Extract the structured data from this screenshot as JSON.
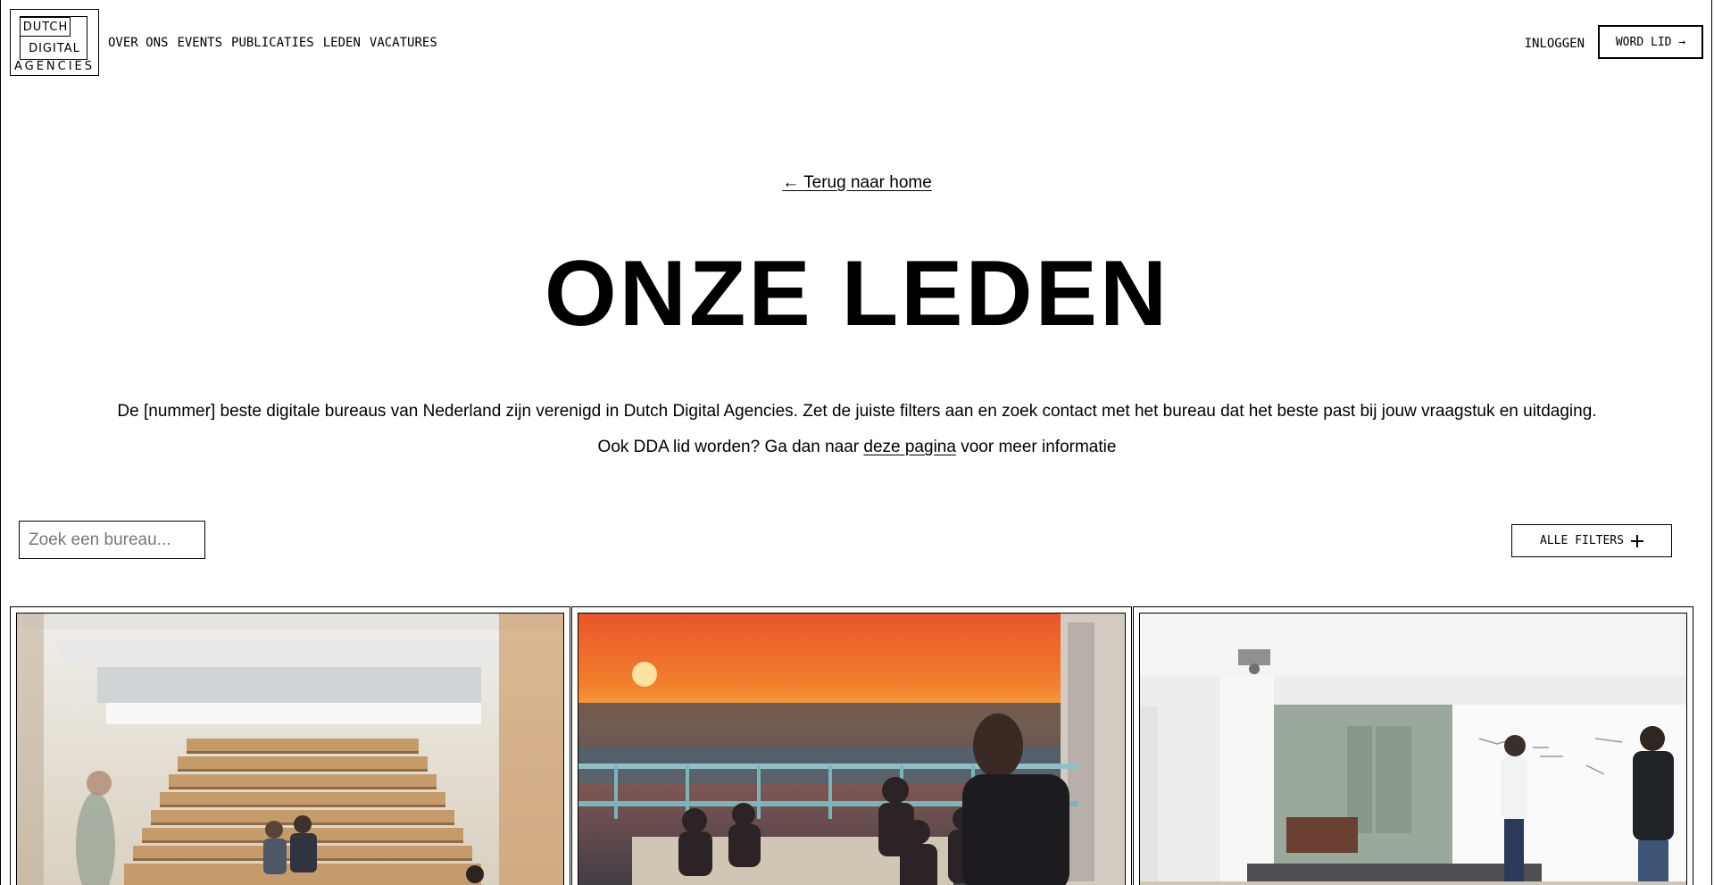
{
  "header": {
    "logo": {
      "line1": "DUTCH",
      "line2": "DIGITAL",
      "line3": "AGENCIES"
    },
    "nav": [
      {
        "label": "OVER ONS"
      },
      {
        "label": "EVENTS"
      },
      {
        "label": "PUBLICATIES"
      },
      {
        "label": "LEDEN"
      },
      {
        "label": "VACATURES"
      }
    ],
    "login_label": "INLOGGEN",
    "join_label": "WORD LID →"
  },
  "hero": {
    "back_link": "← Terug naar home",
    "title": "ONZE LEDEN",
    "intro": "De [nummer] beste digitale bureaus van Nederland zijn verenigd in Dutch Digital Agencies. Zet de juiste filters aan en zoek contact met het bureau dat het beste past bij jouw vraagstuk en uitdaging.",
    "intro2_prefix": "Ook DDA lid worden? Ga dan naar ",
    "intro2_link": "deze pagina",
    "intro2_suffix": " voor meer informatie"
  },
  "search": {
    "placeholder": "Zoek een bureau..."
  },
  "filters": {
    "label": "ALLE FILTERS",
    "icon": "plus-icon"
  },
  "members": [
    {
      "image": "office-staircase-photo"
    },
    {
      "image": "rooftop-sunset-photo"
    },
    {
      "image": "meeting-room-whiteboard-photo"
    }
  ]
}
